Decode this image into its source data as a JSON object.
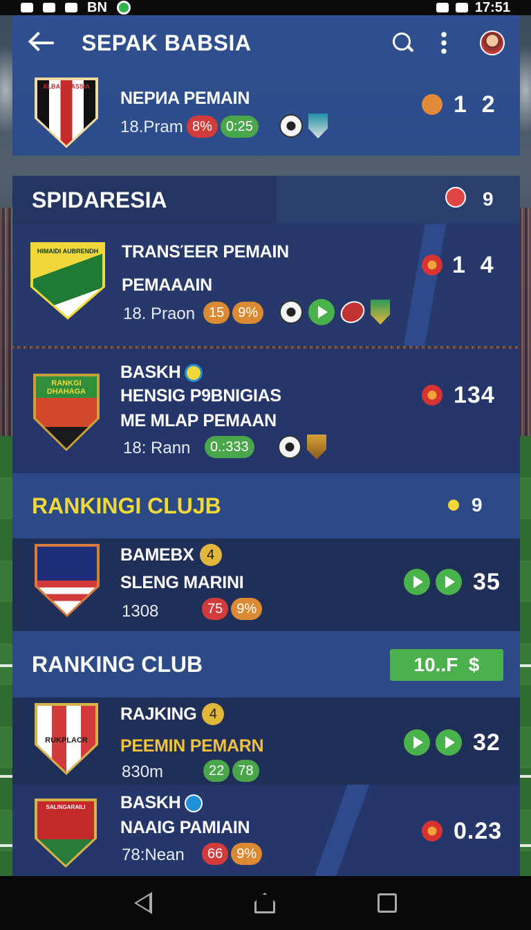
{
  "status_bar": {
    "left_text": "BN",
    "time": "17:51"
  },
  "app_bar": {
    "title": "SEPAK BABSIA"
  },
  "featured": {
    "title": "NEPИA PEMAIN",
    "sub": "18.Pram",
    "pills": [
      "8%",
      "0:25"
    ],
    "score": "1  2"
  },
  "sections": [
    {
      "title": "SPIDARESIA",
      "count": "9"
    },
    {
      "title": "RANKINGI CLUJB",
      "count": "9"
    },
    {
      "title": "RANKING CLUB",
      "badge": "10..F  $"
    }
  ],
  "rows": [
    {
      "title": "TRANSΈER PEMAIN",
      "title2": "PEMAAAIN",
      "sub": "18. Praon",
      "pills": [
        "15",
        "9%"
      ],
      "score": "1  4"
    },
    {
      "title": "BASKH",
      "title2": "HENSIG P9BNIGIAS",
      "title3": "ME MLAP PEMAAN",
      "sub": "18: Rann",
      "pills": [
        "0.:333"
      ],
      "score": "134",
      "crest_text": "RANKGI\nDHAHAGA"
    },
    {
      "title": "BAMEBX",
      "badge": "4",
      "title2": "SLENG MARINI",
      "sub": "1308",
      "pills": [
        "75",
        "9%"
      ],
      "score": "35"
    },
    {
      "title": "RAJKING",
      "badge": "4",
      "title2": "PEEMIN PEMARN",
      "sub": "830m",
      "pills": [
        "22",
        "78"
      ],
      "score": "32",
      "crest_text": "RUKPLACR"
    },
    {
      "title": "BASKH",
      "title2": "NAAIG PAMIAIN",
      "sub": "78:Nean",
      "pills": [
        "66",
        "9%"
      ],
      "score": "0.23",
      "crest_text": "SALINGARAILI"
    }
  ],
  "crest_texts": {
    "featured": "ALBAN BASSIA",
    "transfer": "HIMAIDI AUBRENDH"
  },
  "colors": {
    "accent_green": "#4aa64a",
    "accent_red": "#d23b3b",
    "accent_orange": "#d98a32",
    "accent_yellow": "#f0d73a",
    "panel_blue": "#2e4a86",
    "panel_dark": "#24345e"
  }
}
